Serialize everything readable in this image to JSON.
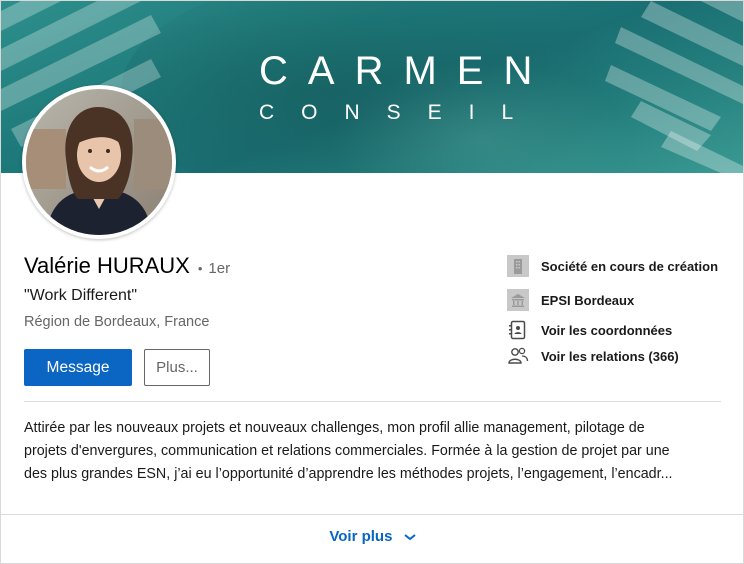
{
  "banner": {
    "brand_line_1": "CARMEN",
    "brand_line_2": "CONSEIL"
  },
  "profile": {
    "name": "Valérie HURAUX",
    "degree_dot": "•",
    "degree": "1er",
    "headline": "\"Work Different\"",
    "location": "Région de Bordeaux, France"
  },
  "actions": {
    "message_label": "Message",
    "more_label": "Plus..."
  },
  "side_info": [
    {
      "icon": "building-icon",
      "label": "Société en cours de création"
    },
    {
      "icon": "school-icon",
      "label": "EPSI Bordeaux"
    },
    {
      "icon": "contact-card-icon",
      "label": "Voir les coordonnées"
    },
    {
      "icon": "people-icon",
      "label": "Voir les relations (366)"
    }
  ],
  "summary": {
    "lines": [
      "Attirée par les nouveaux projets et nouveaux challenges, mon profil allie management, pilotage de",
      "projets d'envergures, communication et relations commerciales. Formée à la gestion de projet par une",
      "des plus grandes ESN, j’ai eu l’opportunité d’apprendre les méthodes projets, l’engagement, l’encadr..."
    ]
  },
  "footer": {
    "see_more_label": "Voir plus"
  },
  "colors": {
    "accent": "#0a66c2",
    "banner_teal": "#1e7a7a"
  }
}
